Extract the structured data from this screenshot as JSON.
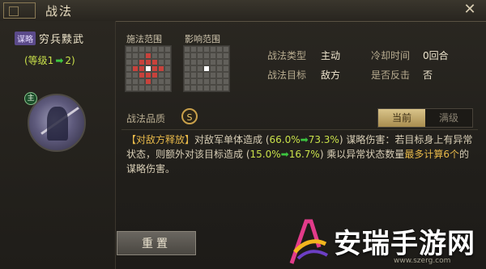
{
  "window": {
    "title": "战法"
  },
  "skill": {
    "tag": "谋略",
    "name": "穷兵黩武",
    "level_prefix": "(等级1",
    "level_arrow": "➡",
    "level_suffix": "2)",
    "badge": "主"
  },
  "ranges": {
    "cast_label": "施法范围",
    "effect_label": "影响范围"
  },
  "info": {
    "type_key": "战法类型",
    "type_val": "主动",
    "cooldown_key": "冷却时间",
    "cooldown_val": "0回合",
    "target_key": "战法目标",
    "target_val": "敌方",
    "counter_key": "是否反击",
    "counter_val": "否"
  },
  "quality": {
    "label": "战法品质",
    "grade": "S"
  },
  "tabs": {
    "current": "当前",
    "max": "满级"
  },
  "description": {
    "p1": "【对敌方释放】",
    "p2": "对敌军单体造成 (",
    "p3": "66.0%",
    "p4": "➡",
    "p5": "73.3%",
    "p6": ") 谋略伤害：若目标身上有异常状态，则额外对该目标造成 (",
    "p7": "15.0%",
    "p8": "➡",
    "p9": "16.7%",
    "p10": ") 乘以异常状态数量",
    "p11": "最多计算6个",
    "p12": "的谋略伤害。"
  },
  "buttons": {
    "reset": "重置"
  },
  "watermark": {
    "text": "安瑞手游网",
    "url": "www.szerg.com"
  },
  "colors": {
    "accent": "#c8a24a",
    "highlight": "#e8b94a",
    "range_red": "#c8423c"
  },
  "icons": {
    "close": "close-icon",
    "quality": "quality-s-icon",
    "ornament": "title-ornament-icon"
  }
}
